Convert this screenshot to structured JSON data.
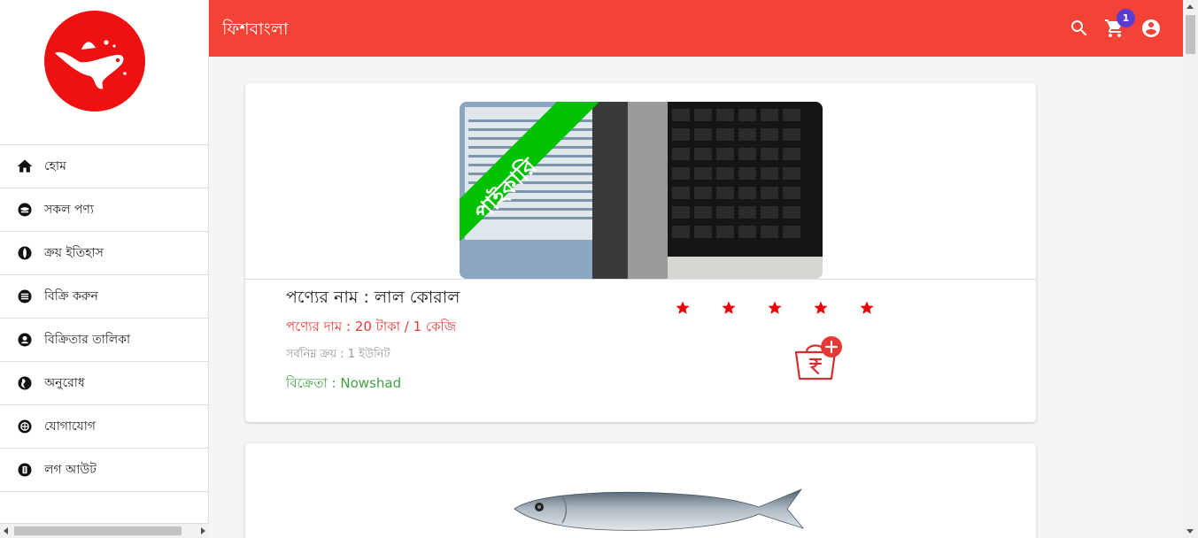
{
  "app": {
    "title": "ফিশবাংলা"
  },
  "header": {
    "cart_count": "1"
  },
  "sidebar": {
    "items": [
      {
        "label": "হোম",
        "icon": "home-icon"
      },
      {
        "label": "সকল পণ্য",
        "icon": "products-icon"
      },
      {
        "label": "ক্রয় ইতিহাস",
        "icon": "history-icon"
      },
      {
        "label": "বিক্রি করুন",
        "icon": "sell-icon"
      },
      {
        "label": "বিক্রিতার তালিকা",
        "icon": "seller-list-icon"
      },
      {
        "label": "অনুরোধ",
        "icon": "request-icon"
      },
      {
        "label": "যোগাযোগ",
        "icon": "contact-icon"
      },
      {
        "label": "লগ আউট",
        "icon": "logout-icon"
      }
    ]
  },
  "products": [
    {
      "ribbon": "পাইকারি",
      "name": "পণ্যের নাম : লাল কোরাল",
      "price": "পণ্যের দাম : 20 টাকা / 1 কেজি",
      "min_purchase": "সর্বনিম্ন ক্রয় : 1 ইউনিট",
      "seller": "বিক্রেতা : Nowshad",
      "rating": 5
    },
    {
      "image": "fish-photo"
    }
  ],
  "colors": {
    "primary": "#f44336",
    "badge": "#5c3bd1",
    "price": "#e53935",
    "seller": "#43a047",
    "ribbon": "#00c200"
  }
}
